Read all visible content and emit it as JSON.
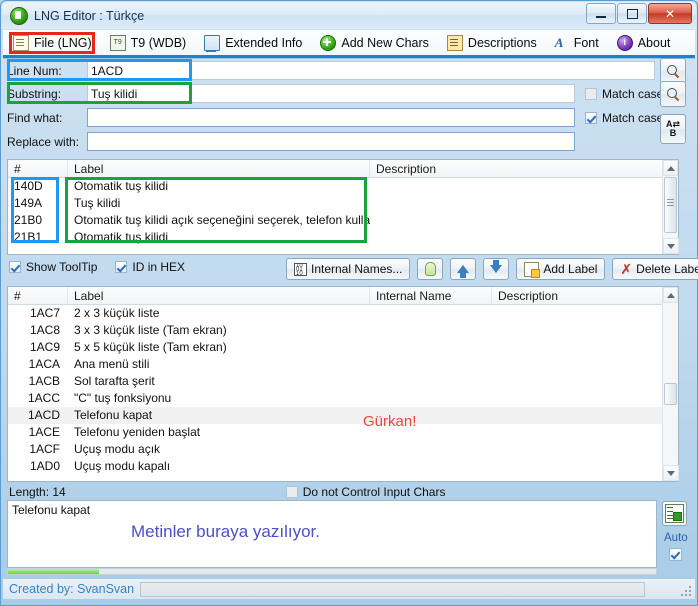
{
  "window": {
    "title": "LNG Editor : Türkçe",
    "app_icon": "green-globe-icon",
    "minimize_label": "Minimize",
    "maximize_label": "Maximize",
    "close_label": "Close"
  },
  "toolbar": {
    "items": [
      {
        "label": "File (LNG)",
        "icon": "file-icon"
      },
      {
        "label": "T9 (WDB)",
        "icon": "t9-icon"
      },
      {
        "label": "Extended Info",
        "icon": "monitor-icon"
      },
      {
        "label": "Add New Chars",
        "icon": "green-plus-icon"
      },
      {
        "label": "Descriptions",
        "icon": "list-icon"
      },
      {
        "label": "Font",
        "icon": "font-a-icon"
      },
      {
        "label": "About",
        "icon": "info-icon"
      }
    ]
  },
  "search": {
    "line_num_label": "Line Num:",
    "line_num_value": "1ACD",
    "substring_label": "Substring:",
    "substring_value": "Tuş kilidi",
    "find_what_label": "Find what:",
    "find_what_value": "",
    "replace_with_label": "Replace with:",
    "replace_with_value": "",
    "match_case_1_label": "Match case",
    "match_case_1_checked": false,
    "match_case_2_label": "Match case",
    "match_case_2_checked": true,
    "search_icon_1": "magnifier-icon",
    "search_icon_2": "magnifier-icon",
    "replace_icon": "ab-replace-icon"
  },
  "results_list": {
    "columns": [
      "#",
      "Label",
      "Description"
    ],
    "rows": [
      {
        "id": "140D",
        "label": "Otomatik tuş kilidi",
        "description": ""
      },
      {
        "id": "149A",
        "label": "Tuş kilidi",
        "description": ""
      },
      {
        "id": "21B0",
        "label": "Otomatik tuş kilidi açık seçeneğini seçerek, telefon kullanıl...",
        "description": ""
      },
      {
        "id": "21B1",
        "label": "Otomatik tuş kilidi",
        "description": ""
      }
    ]
  },
  "options_bar": {
    "show_tooltip_label": "Show ToolTip",
    "show_tooltip_checked": true,
    "id_in_hex_label": "ID in HEX",
    "id_in_hex_checked": true,
    "internal_names_label": "Internal Names...",
    "internal_names_icon": "binary-icon",
    "hint_icon": "lightbulb-icon",
    "move_up_icon": "arrow-up-icon",
    "move_down_icon": "arrow-down-icon",
    "add_label_label": "Add Label",
    "add_label_icon": "add-label-icon",
    "delete_label_label": "Delete Label",
    "delete_label_icon": "red-x-icon"
  },
  "main_list": {
    "columns": [
      "#",
      "Label",
      "Internal Name",
      "Description"
    ],
    "rows": [
      {
        "id": "1AC7",
        "label": "2 x 3 küçük liste",
        "internal": "",
        "description": "",
        "selected": false
      },
      {
        "id": "1AC8",
        "label": "3 x 3 küçük liste (Tam ekran)",
        "internal": "",
        "description": "",
        "selected": false
      },
      {
        "id": "1AC9",
        "label": "5 x 5 küçük liste (Tam ekran)",
        "internal": "",
        "description": "",
        "selected": false
      },
      {
        "id": "1ACA",
        "label": "Ana menü stili",
        "internal": "",
        "description": "",
        "selected": false
      },
      {
        "id": "1ACB",
        "label": "Sol tarafta şerit",
        "internal": "",
        "description": "",
        "selected": false
      },
      {
        "id": "1ACC",
        "label": "\"C\" tuş fonksiyonu",
        "internal": "",
        "description": "",
        "selected": false
      },
      {
        "id": "1ACD",
        "label": "Telefonu kapat",
        "internal": "",
        "description": "",
        "selected": true
      },
      {
        "id": "1ACE",
        "label": "Telefonu yeniden başlat",
        "internal": "",
        "description": "",
        "selected": false
      },
      {
        "id": "1ACF",
        "label": "Uçuş modu açık",
        "internal": "",
        "description": "",
        "selected": false
      },
      {
        "id": "1AD0",
        "label": "Uçuş modu kapalı",
        "internal": "",
        "description": "",
        "selected": false
      }
    ]
  },
  "editor": {
    "length_label": "Length: 14",
    "do_not_control_label": "Do not Control Input Chars",
    "do_not_control_checked": false,
    "text_value": "Telefonu kapat",
    "auto_label": "Auto",
    "auto_checked": true,
    "auto_icon": "apply-list-icon",
    "progress_percent": 14
  },
  "statusbar": {
    "created_by": "Created by: SvanSvan"
  },
  "annotations": [
    {
      "name": "file-tab-highlight",
      "color": "#e8261a",
      "shape": "rect"
    },
    {
      "name": "line-num-highlight",
      "color": "#2196f3",
      "shape": "rect"
    },
    {
      "name": "substring-highlight",
      "color": "#1aa33a",
      "shape": "rect"
    },
    {
      "name": "result-ids-highlight",
      "color": "#2196f3",
      "shape": "rect"
    },
    {
      "name": "result-labels-highlight",
      "color": "#1aa33a",
      "shape": "rect"
    },
    {
      "name": "gurkan-note",
      "color": "#e8473b",
      "text": "Gürkan!"
    },
    {
      "name": "memo-note",
      "color": "#4e4ec8",
      "text": "Metinler buraya yazılıyor."
    }
  ]
}
